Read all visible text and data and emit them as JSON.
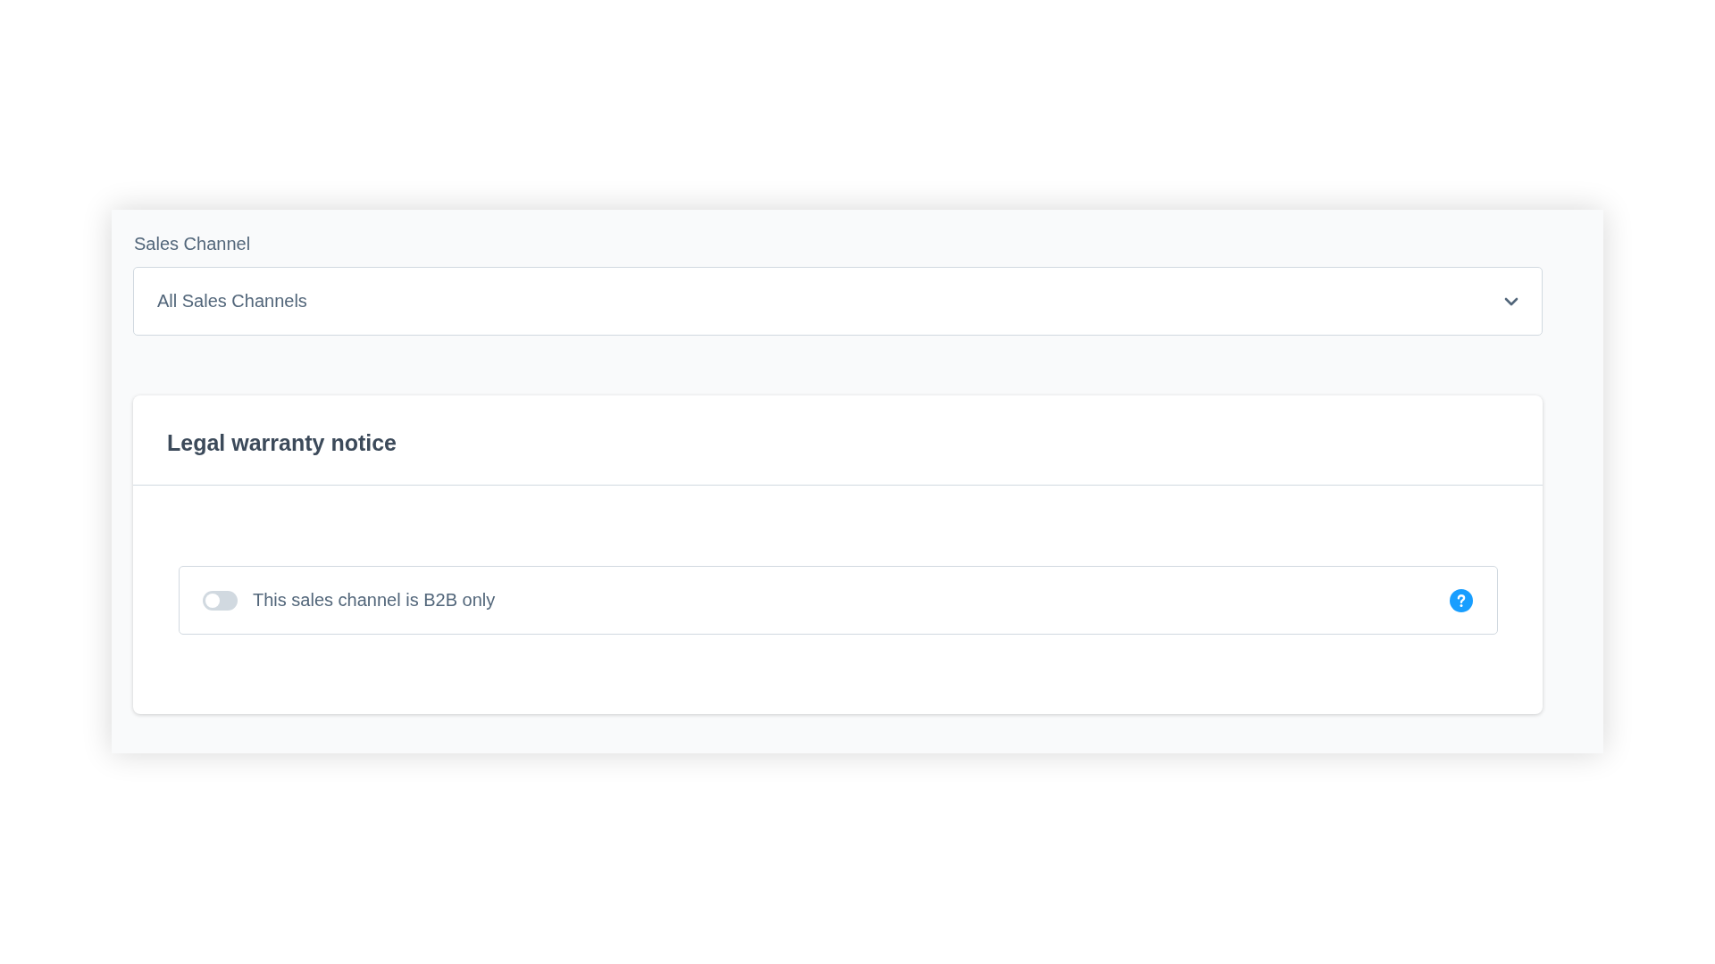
{
  "sales_channel": {
    "label": "Sales Channel",
    "value": "All Sales Channels"
  },
  "card": {
    "title": "Legal warranty notice",
    "switch": {
      "label": "This sales channel is B2B only",
      "on": false
    }
  }
}
